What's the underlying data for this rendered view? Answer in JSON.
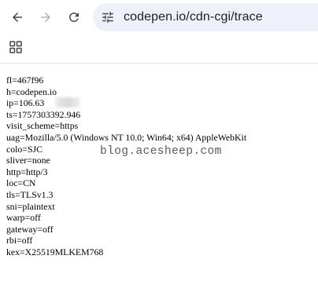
{
  "browser": {
    "url": "codepen.io/cdn-cgi/trace",
    "icons": {
      "back": "arrow-left-icon",
      "forward": "arrow-right-icon",
      "reload": "reload-icon",
      "site_info": "tune-icon",
      "apps": "apps-grid-icon"
    }
  },
  "trace": {
    "lines": [
      "fl=467f96",
      "h=codepen.io",
      "ip=106.63",
      "ts=1757303392.946",
      "visit_scheme=https",
      "uag=Mozilla/5.0 (Windows NT 10.0; Win64; x64) AppleWebKit",
      "colo=SJC",
      "sliver=none",
      "http=http/3",
      "loc=CN",
      "tls=TLSv1.3",
      "sni=plaintext",
      "warp=off",
      "gateway=off",
      "rbi=off",
      "kex=X25519MLKEM768"
    ]
  },
  "watermark": "blog.acesheep.com"
}
